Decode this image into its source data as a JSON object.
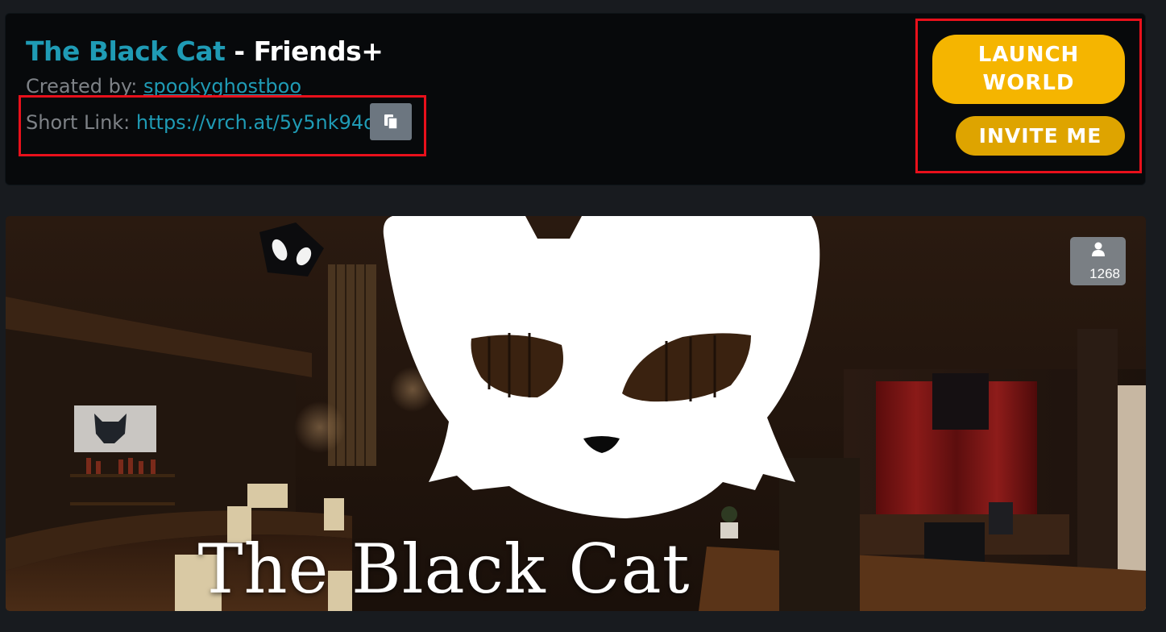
{
  "world": {
    "name": "The Black Cat",
    "separator": " - ",
    "visibility": "Friends+",
    "created_by_label": "Created by: ",
    "author": "spookyghostboo",
    "short_link_label": "Short Link: ",
    "short_link": "https://vrch.at/5y5nk94d"
  },
  "actions": {
    "launch_label": "LAUNCH WORLD",
    "invite_label": "INVITE ME"
  },
  "image": {
    "banner_text": "The Black Cat",
    "occupancy": "1268"
  },
  "icons": {
    "copy": "copy-icon",
    "occupants": "person-icon"
  },
  "colors": {
    "accent": "#1f9bb5",
    "launch": "#f5b500",
    "invite": "#dea400",
    "annotation": "#e8101b",
    "card_bg": "#07090b",
    "page_bg": "#181b1f"
  }
}
